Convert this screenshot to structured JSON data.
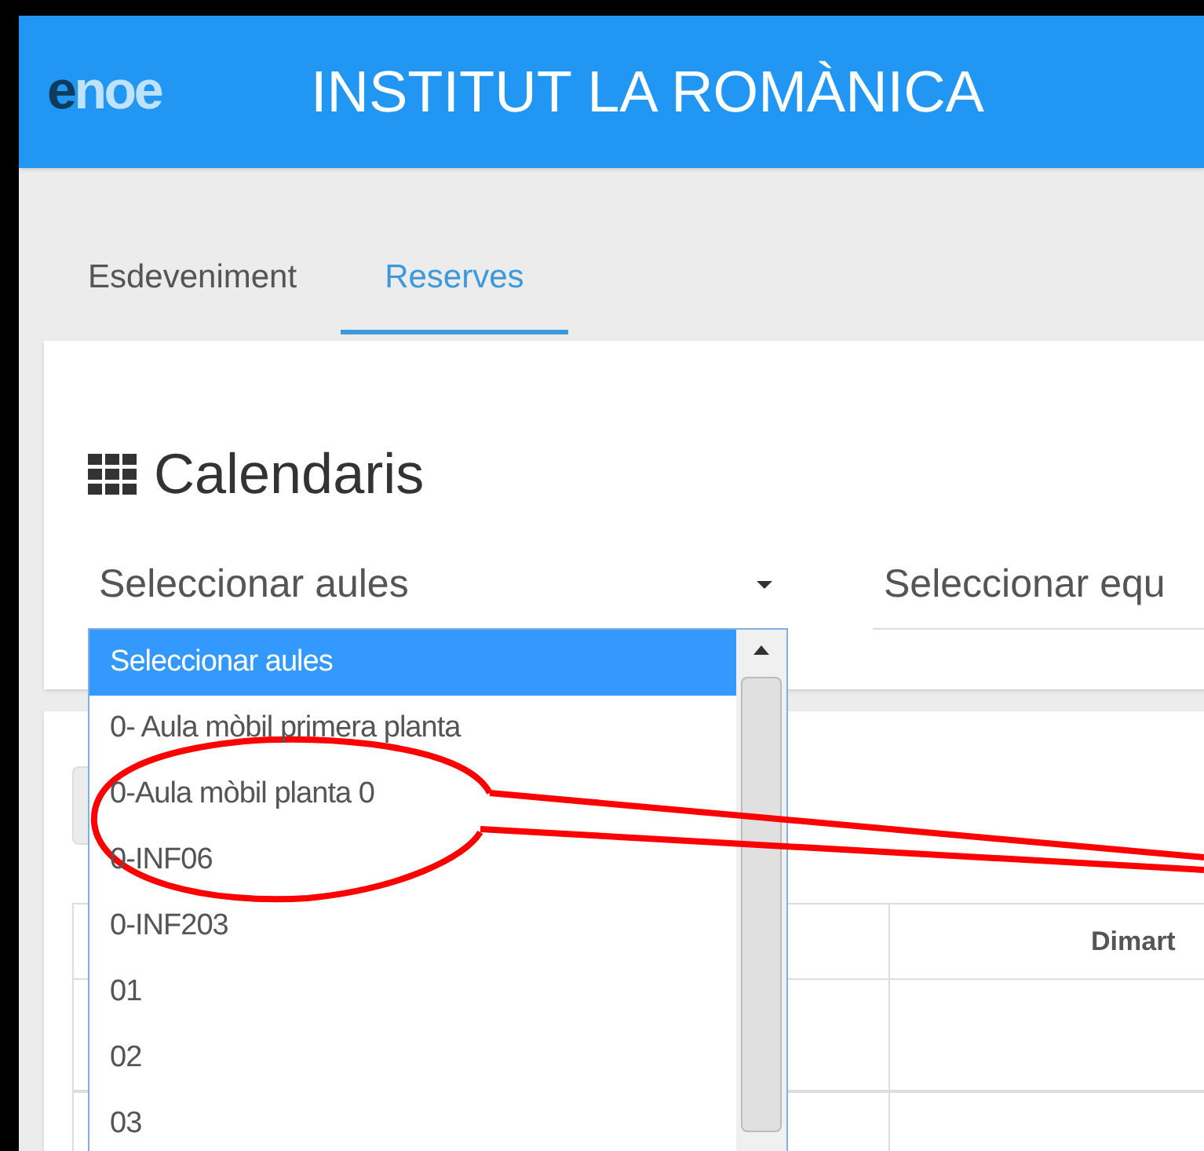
{
  "header": {
    "logo": "enoe",
    "title": "INSTITUT LA ROMÀNICA"
  },
  "tabs": [
    {
      "label": "Esdeveniment",
      "selected": false
    },
    {
      "label": "Reserves",
      "selected": true
    }
  ],
  "calendar_card": {
    "title": "Calendaris",
    "selects": [
      {
        "value": "Seleccionar aules",
        "open": true,
        "options": [
          {
            "label": "Seleccionar aules",
            "selected": true
          },
          {
            "label": "0- Aula mòbil primera planta",
            "selected": false
          },
          {
            "label": "0-Aula mòbil planta 0",
            "selected": false
          },
          {
            "label": "0-INF06",
            "selected": false
          },
          {
            "label": "0-INF203",
            "selected": false
          },
          {
            "label": "01",
            "selected": false
          },
          {
            "label": "02",
            "selected": false
          },
          {
            "label": "03",
            "selected": false
          }
        ]
      },
      {
        "value": "Seleccionar equ"
      }
    ]
  },
  "table": {
    "headers": [
      "Dimart"
    ]
  }
}
